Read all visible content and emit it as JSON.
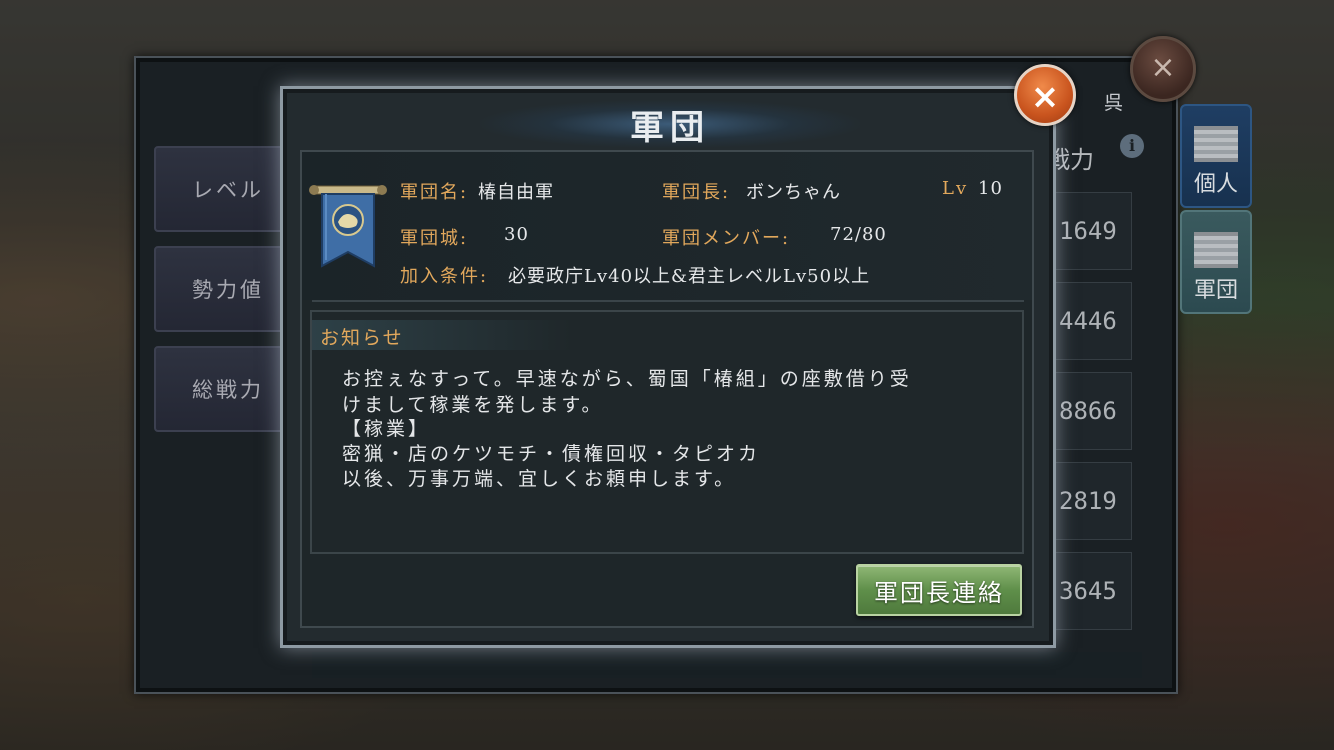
{
  "background_panel": {
    "side_tabs": [
      "レベル",
      "勢力値",
      "総戦力"
    ],
    "kingdom": "呉",
    "column_header": "戦力",
    "rank_values": [
      "1649",
      "4446",
      "8866",
      "2819",
      "3645"
    ],
    "right_tabs": [
      "個人",
      "軍団"
    ]
  },
  "dialog": {
    "title": "軍団",
    "close_glyph": "×",
    "info": {
      "name_label": "軍団名:",
      "name_value": "椿自由軍",
      "leader_label": "軍団長:",
      "leader_value": "ボンちゃん",
      "level_label": "Lv",
      "level_value": "10",
      "castle_label": "軍団城:",
      "castle_value": "30",
      "members_label": "軍団メンバー:",
      "members_value": "72/80",
      "join_label": "加入条件:",
      "join_value": "必要政庁Lv40以上&君主レベルLv50以上"
    },
    "notice": {
      "title": "お知らせ",
      "lines": [
        "お控ぇなすって。早速ながら、蜀国「椿組」の座敷借り受",
        "けまして稼業を発します。",
        "【稼業】",
        "密猟・店のケツモチ・債権回収・タピオカ",
        "以後、万事万端、宜しくお頼申します。"
      ]
    },
    "contact_button": "軍団長連絡"
  },
  "colors": {
    "label_orange": "#e2a85c",
    "close_orange": "#d5622a",
    "button_green": "#6b9a55",
    "banner_blue": "#3f6ea6"
  }
}
